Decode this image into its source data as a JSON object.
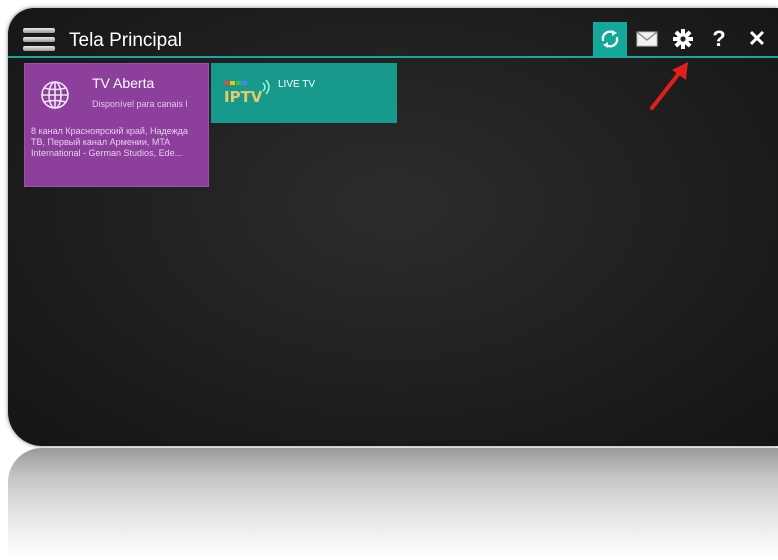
{
  "header": {
    "title": "Tela Principal",
    "actions": [
      {
        "icon": "refresh-icon",
        "label": ""
      },
      {
        "icon": "mail-icon",
        "label": ""
      },
      {
        "icon": "gear-icon",
        "label": ""
      },
      {
        "icon": "help-icon",
        "label": "?"
      },
      {
        "icon": "close-icon",
        "label": "✕"
      }
    ],
    "accent": "#18a99c"
  },
  "tiles": [
    {
      "icon": "globe-icon",
      "name": "TV Aberta",
      "description": "Disponível para canais l",
      "channels": "8 канал Красноярский край, Надежда ТВ, Первый канал Армении, MTA International - German Studios, Ede...",
      "color": "#8d3f9c"
    },
    {
      "icon": "iptv-logo-icon",
      "logo_text": "IPTV",
      "name": "LIVE TV",
      "color": "#17998c"
    }
  ],
  "annotation": {
    "icon": "red-arrow-icon",
    "color": "#e0201e"
  }
}
